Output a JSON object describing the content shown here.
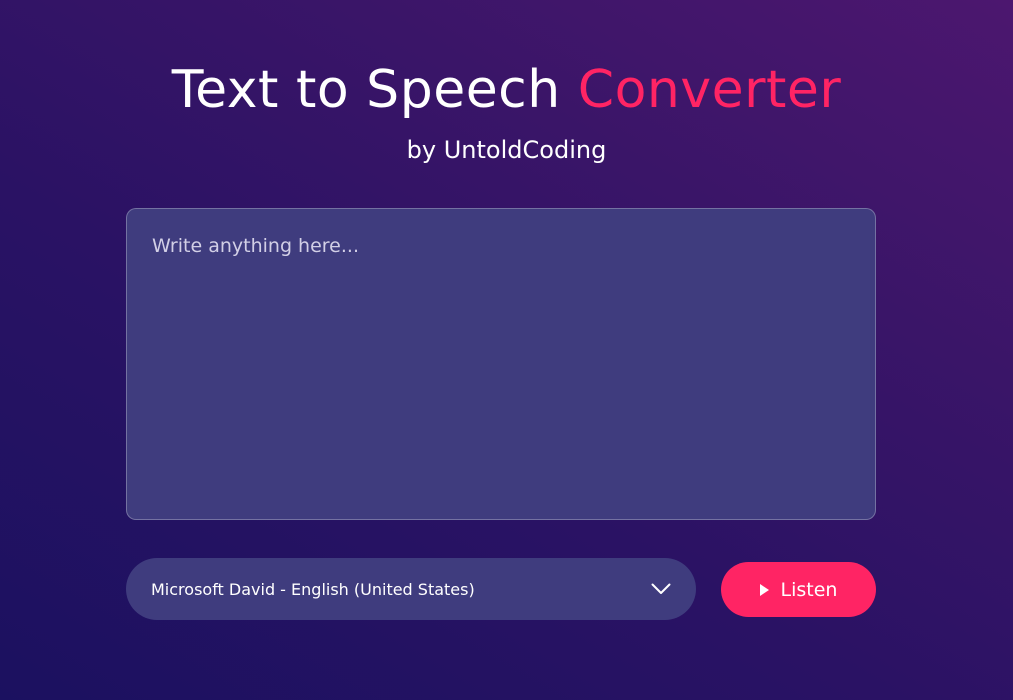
{
  "header": {
    "title_main": "Text to Speech",
    "title_accent": "Converter",
    "subtitle": "by UntoldCoding"
  },
  "text_input": {
    "placeholder": "Write anything here...",
    "value": ""
  },
  "voice_select": {
    "selected": "Microsoft David - English (United States)",
    "icon": "chevron-down-icon"
  },
  "listen_button": {
    "label": "Listen",
    "icon": "play-icon"
  },
  "colors": {
    "accent": "#ff2464",
    "panel": "#3f3c7e",
    "background_start": "#1b1160",
    "background_end": "#4c176f"
  }
}
